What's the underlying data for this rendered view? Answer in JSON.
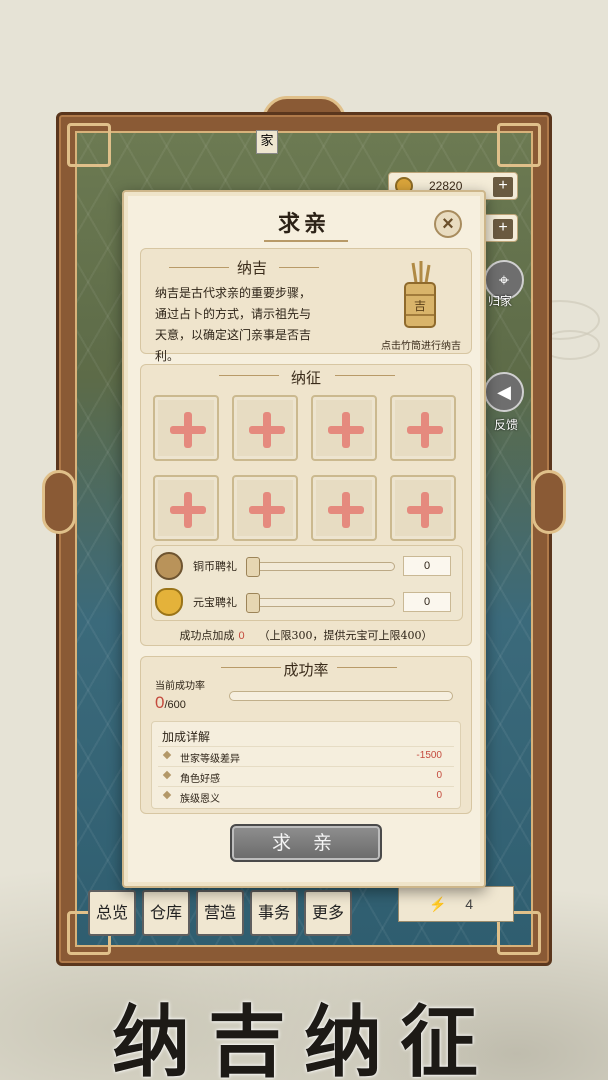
{
  "background": {
    "resources": [
      {
        "icon": "copper-coin-icon",
        "value": "22820"
      },
      {
        "icon": "ingot-icon",
        "value": ""
      }
    ],
    "hud": {
      "return_home": "归家",
      "feedback": "反馈"
    },
    "bottom_nav": [
      "总览",
      "仓库",
      "营造",
      "事务",
      "更多"
    ],
    "energy_value": "4",
    "map_tag": "家"
  },
  "modal": {
    "title": "求亲",
    "section_naji": {
      "heading": "纳吉",
      "description": "纳吉是古代求亲的重要步骤，通过占卜的方式，请示祖先与天意，以确定这门亲事是否吉利。",
      "bamboo_tip": "点击竹筒进行纳吉",
      "bamboo_char": "吉"
    },
    "section_nazheng": {
      "heading": "纳征",
      "slots": [
        1,
        2,
        3,
        4,
        5,
        6,
        7,
        8
      ],
      "gifts": [
        {
          "icon": "copper-coin-icon",
          "label": "铜币聘礼",
          "value": "0",
          "fraction": 0
        },
        {
          "icon": "gold-ingot-icon",
          "label": "元宝聘礼",
          "value": "0",
          "fraction": 0
        }
      ],
      "bonus_label": "成功点加成",
      "bonus_value": "0",
      "bonus_note": "（上限300，提供元宝可上限400）"
    },
    "section_rate": {
      "heading": "成功率",
      "current_label": "当前成功率",
      "current_value": "0",
      "current_total": "/600",
      "progress": 0,
      "detail_title": "加成详解",
      "details": [
        {
          "name": "世家等级差异",
          "value": "-1500"
        },
        {
          "name": "角色好感",
          "value": "0"
        },
        {
          "name": "族级恩义",
          "value": "0"
        }
      ]
    },
    "button": "求 亲"
  },
  "caption": "纳吉纳征",
  "colors": {
    "accent_red": "#c44b3e",
    "frame_wood": "#8a5a35",
    "panel_bg": "#efe4cc"
  }
}
